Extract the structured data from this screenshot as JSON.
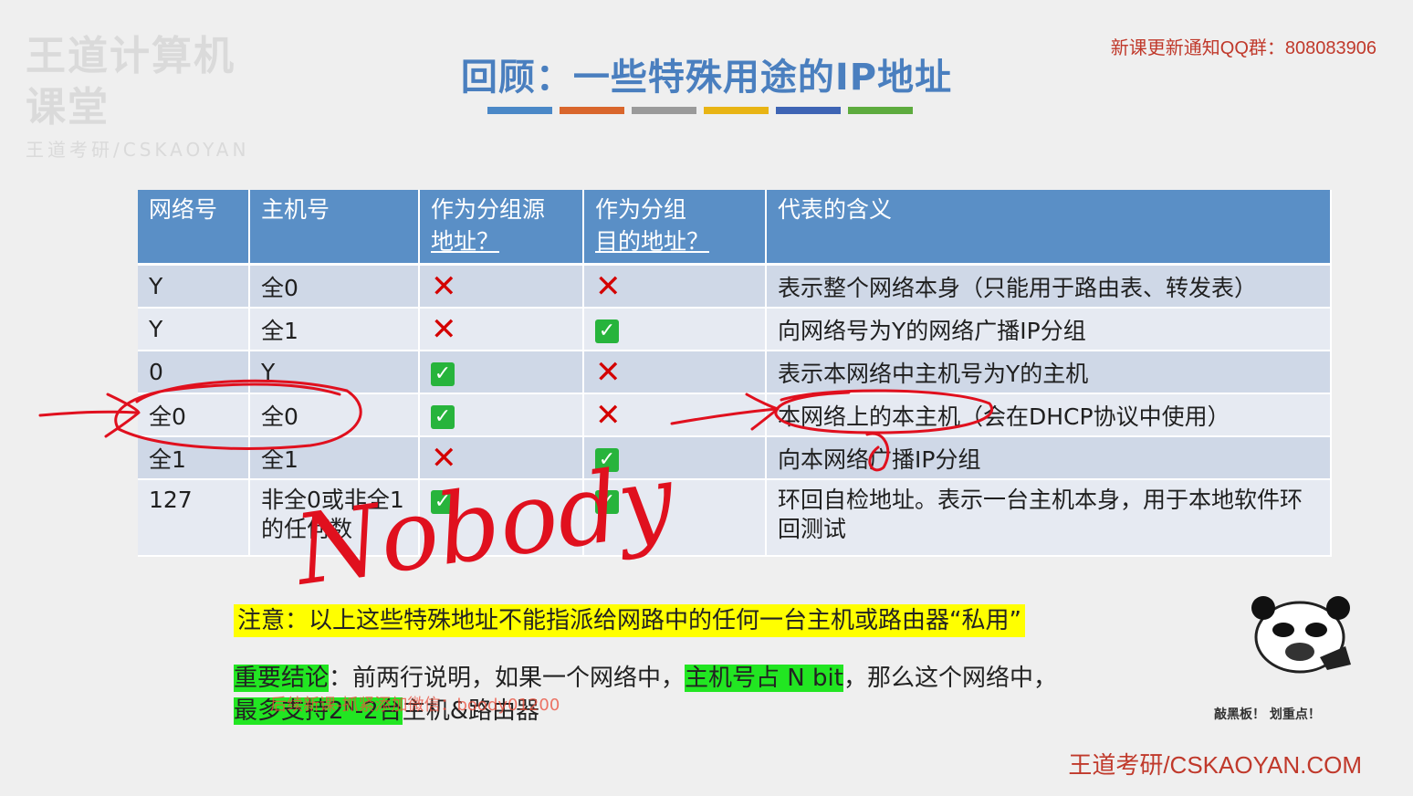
{
  "watermark": {
    "logo_main": "王道计算机课堂",
    "logo_sub": "王道考研/CSKAOYAN"
  },
  "qq_notice": "新课更新通知QQ群：808083906",
  "title": "回顾：一些特殊用途的IP地址",
  "title_bar_colors": [
    "#4a88c7",
    "#d9662c",
    "#9a9a9a",
    "#e8b414",
    "#3e64b4",
    "#5dab3e"
  ],
  "table": {
    "headers": {
      "net": "网络号",
      "host": "主机号",
      "src_line1": "作为分组源",
      "src_line2": "地址？",
      "dst_line1": "作为分组",
      "dst_line2": "目的地址？",
      "meaning": "代表的含义"
    },
    "rows": [
      {
        "net": "Y",
        "host": "全0",
        "src": "x",
        "dst": "x",
        "meaning": "表示整个网络本身（只能用于路由表、转发表）"
      },
      {
        "net": "Y",
        "host": "全1",
        "src": "x",
        "dst": "ok",
        "meaning": "向网络号为Y的网络广播IP分组"
      },
      {
        "net": "0",
        "host": "Y",
        "src": "ok",
        "dst": "x",
        "meaning": "表示本网络中主机号为Y的主机"
      },
      {
        "net": "全0",
        "host": "全0",
        "src": "ok",
        "dst": "x",
        "meaning": "本网络上的本主机（会在DHCP协议中使用）"
      },
      {
        "net": "全1",
        "host": "全1",
        "src": "x",
        "dst": "ok",
        "meaning": "向本网络广播IP分组"
      },
      {
        "net": "127",
        "host": "非全0或非全1的任何数",
        "src": "ok",
        "dst": "ok",
        "meaning": "环回自检地址。表示一台主机本身，用于本地软件环回测试"
      }
    ]
  },
  "note": "注意：以上这些特殊地址不能指派给网路中的任何一台主机或路由器“私用”",
  "conclusion": {
    "label": "重要结论",
    "text1": "：前两行说明，如果一个网络中，",
    "highlight": "主机号占 N bit",
    "text2": "，那么这个网络中，",
    "line2_highlight": "最多支持2ᴺ-2台",
    "line2_text": "主机&路由器"
  },
  "wechat_watermark": "后续新课-抓紧添加微信：boody01200",
  "panda_caption": "敲黑板！ 划重点！",
  "brand": "王道考研/CSKAOYAN.COM",
  "handwriting": "Nobody",
  "colors": {
    "x_mark": "#d40000",
    "ok_mark": "#27b43c",
    "header_bg": "#5a8fc6",
    "highlight_yellow": "#ffff00",
    "highlight_green": "#22e622",
    "ink": "#e0101e"
  },
  "icons": {
    "x": "cross-icon",
    "ok": "check-icon"
  }
}
